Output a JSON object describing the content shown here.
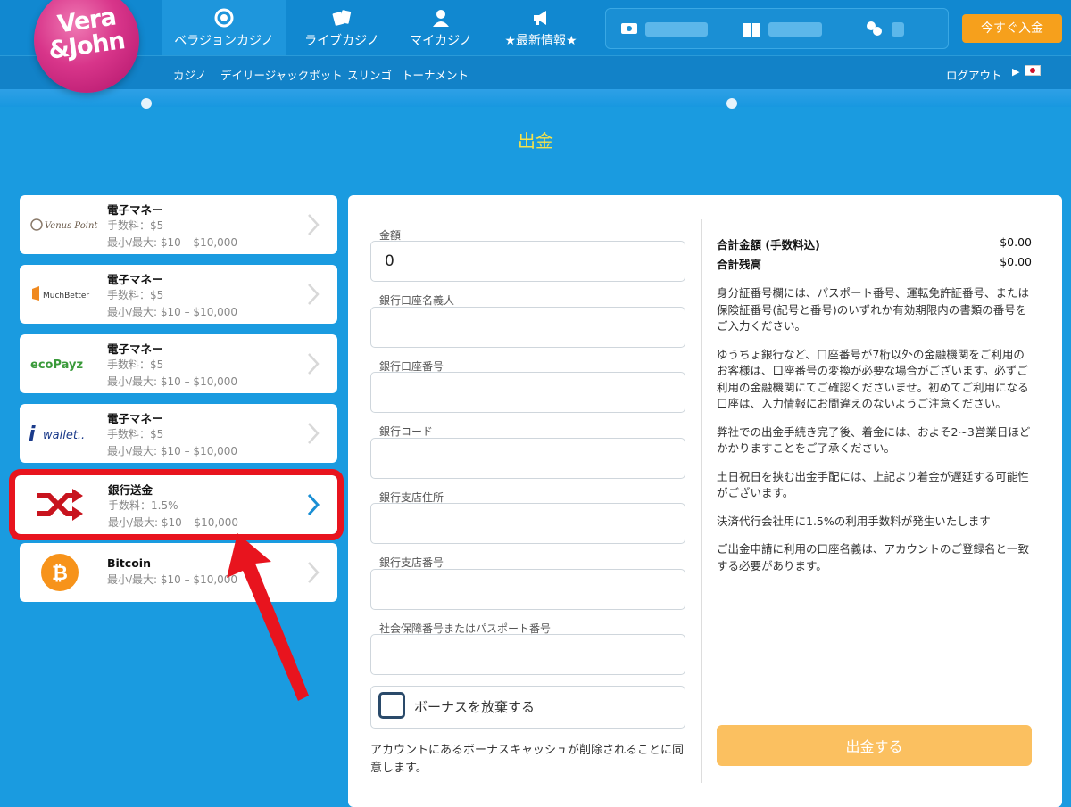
{
  "brand": {
    "line1": "Vera",
    "line2": "&John"
  },
  "nav": {
    "tabs": [
      {
        "label": "ベラジョンカジノ",
        "icon": "chip-icon"
      },
      {
        "label": "ライブカジノ",
        "icon": "cards-icon"
      },
      {
        "label": "マイカジノ",
        "icon": "user-icon"
      },
      {
        "label": "★最新情報★",
        "icon": "megaphone-icon"
      }
    ],
    "deposit_label": "今すぐ入金",
    "sublinks": [
      "カジノ",
      "デイリージャックポット",
      "スリンゴ",
      "トーナメント"
    ],
    "logout": "ログアウト",
    "lang_arrow": "▶"
  },
  "page": {
    "title": "出金"
  },
  "methods": [
    {
      "name": "電子マネー",
      "fee": "手数料：$5",
      "limit": "最小/最大: $10 – $10,000",
      "logo": "Venus Point"
    },
    {
      "name": "電子マネー",
      "fee": "手数料：$5",
      "limit": "最小/最大: $10 – $10,000",
      "logo": "MuchBetter"
    },
    {
      "name": "電子マネー",
      "fee": "手数料：$5",
      "limit": "最小/最大: $10 – $10,000",
      "logo": "ecoPayz"
    },
    {
      "name": "電子マネー",
      "fee": "手数料：$5",
      "limit": "最小/最大: $10 – $10,000",
      "logo": "wallet.."
    },
    {
      "name": "銀行送金",
      "fee": "手数料：1.5%",
      "limit": "最小/最大: $10 – $10,000",
      "logo": ""
    },
    {
      "name": "Bitcoin",
      "fee": "",
      "limit": "最小/最大: $10 – $10,000",
      "logo": ""
    }
  ],
  "form": {
    "amount_label": "金額",
    "amount_value": "0",
    "holder_label": "銀行口座名義人",
    "account_label": "銀行口座番号",
    "code_label": "銀行コード",
    "branch_addr_label": "銀行支店住所",
    "branch_no_label": "銀行支店番号",
    "id_label": "社会保障番号またはパスポート番号",
    "bonus_label": "ボーナスを放棄する",
    "agree_text": "アカウントにあるボーナスキャッシュが削除されることに同意します。"
  },
  "summary": {
    "total_label": "合計金額 (手数料込)",
    "total_value": "$0.00",
    "balance_label": "合計残高",
    "balance_value": "$0.00",
    "notes": [
      "身分証番号欄には、パスポート番号、運転免許証番号、または保険証番号(記号と番号)のいずれか有効期限内の書類の番号をご入力ください。",
      "ゆうちょ銀行など、口座番号が7桁以外の金融機関をご利用のお客様は、口座番号の変換が必要な場合がございます。必ずご利用の金融機関にてご確認くださいませ。初めてご利用になる口座は、入力情報にお間違えのないようご注意ください。",
      "弊社での出金手続き完了後、着金には、およそ2~3営業日ほどかかりますことをご了承ください。",
      "土日祝日を挟む出金手配には、上記より着金が遅延する可能性がございます。",
      "決済代行会社用に1.5%の利用手数料が発生いたします",
      "ご出金申請に利用の口座名義は、アカウントのご登録名と一致する必要があります。"
    ],
    "withdraw_label": "出金する"
  },
  "colors": {
    "accent": "#f6a01c",
    "highlight": "#e8141e",
    "title": "#f6e24a",
    "bg": "#1a9be0"
  }
}
